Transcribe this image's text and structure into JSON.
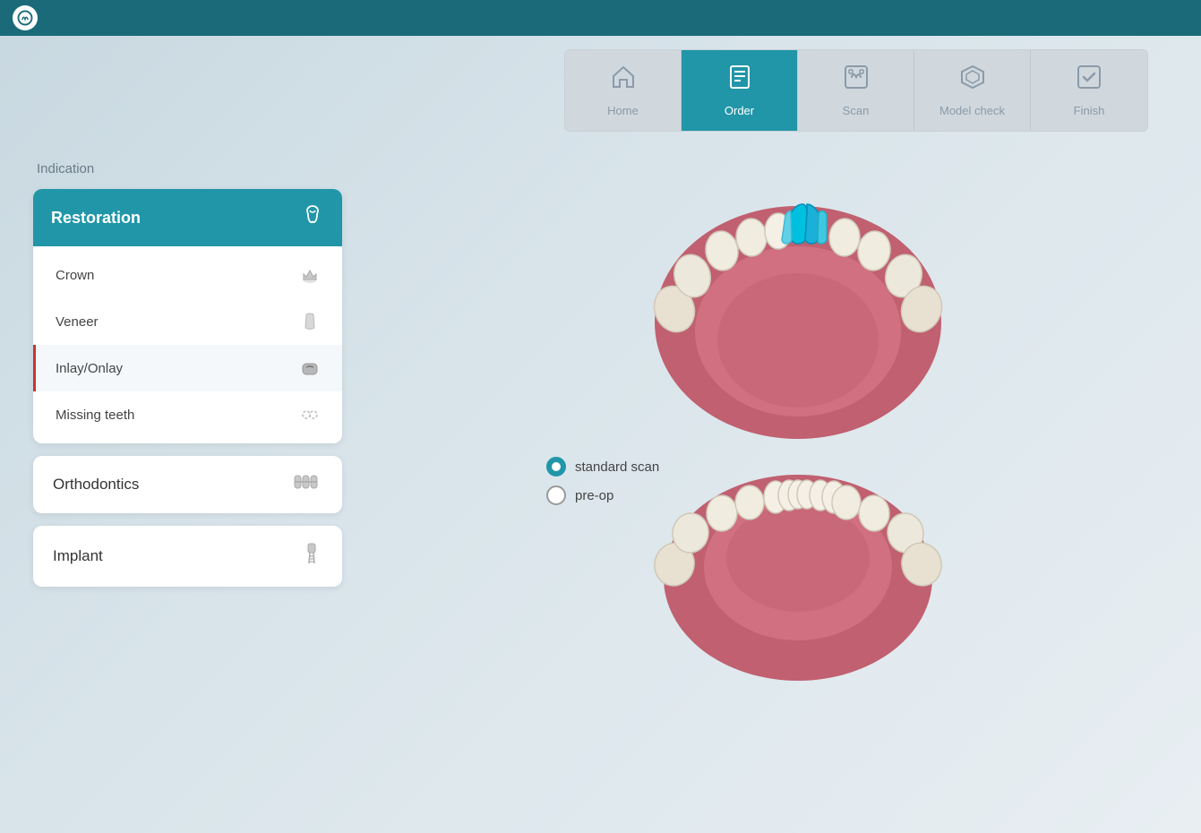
{
  "app": {
    "logo": "🦷"
  },
  "topBar": {
    "bgColor": "#1a6a7a"
  },
  "nav": {
    "tabs": [
      {
        "id": "home",
        "label": "Home",
        "icon": "🏠",
        "active": false
      },
      {
        "id": "order",
        "label": "Order",
        "icon": "📋",
        "active": true
      },
      {
        "id": "scan",
        "label": "Scan",
        "icon": "🦷",
        "active": false
      },
      {
        "id": "model-check",
        "label": "Model check",
        "icon": "⬡",
        "active": false
      },
      {
        "id": "finish",
        "label": "Finish",
        "icon": "☑",
        "active": false
      }
    ]
  },
  "sidebar": {
    "indication_label": "Indication",
    "restoration": {
      "title": "Restoration",
      "items": [
        {
          "id": "crown",
          "label": "Crown",
          "selected": false
        },
        {
          "id": "veneer",
          "label": "Veneer",
          "selected": false
        },
        {
          "id": "inlay-onlay",
          "label": "Inlay/Onlay",
          "selected": true
        },
        {
          "id": "missing-teeth",
          "label": "Missing teeth",
          "selected": false
        }
      ]
    },
    "categories": [
      {
        "id": "orthodontics",
        "label": "Orthodontics"
      },
      {
        "id": "implant",
        "label": "Implant"
      }
    ]
  },
  "scanOptions": [
    {
      "id": "standard-scan",
      "label": "standard scan",
      "checked": true
    },
    {
      "id": "pre-op",
      "label": "pre-op",
      "checked": false
    }
  ]
}
